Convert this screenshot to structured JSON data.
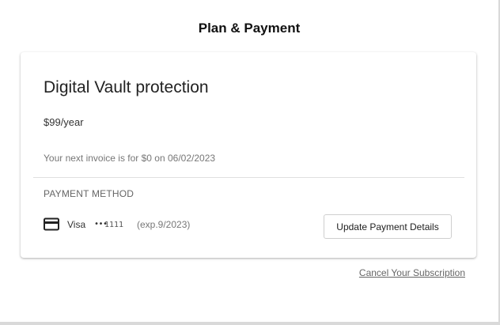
{
  "header": {
    "title": "Plan & Payment"
  },
  "plan": {
    "name": "Digital Vault protection",
    "price": "$99/year",
    "next_invoice": "Your next invoice is for $0 on 06/02/2023"
  },
  "payment_method": {
    "heading": "PAYMENT METHOD",
    "icon": "credit-card-icon",
    "brand": "Visa",
    "masked_dots": "•••",
    "last4": "1111",
    "expiry": "(exp.9/2023)",
    "update_button_label": "Update Payment Details"
  },
  "footer": {
    "cancel_label": "Cancel Your Subscription"
  }
}
